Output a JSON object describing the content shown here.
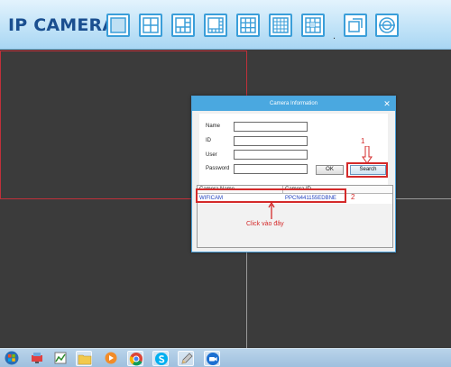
{
  "toolbar": {
    "title": "IP CAMERA",
    "buttons": [
      {
        "name": "layout-1-button",
        "icon": "single-view-icon"
      },
      {
        "name": "layout-4-button",
        "icon": "quad-view-icon"
      },
      {
        "name": "layout-6-button",
        "icon": "six-view-icon"
      },
      {
        "name": "layout-8-button",
        "icon": "eight-view-icon"
      },
      {
        "name": "layout-9-button",
        "icon": "nine-view-icon"
      },
      {
        "name": "layout-16-button",
        "icon": "sixteen-view-icon"
      },
      {
        "name": "layout-custom-button",
        "icon": "custom-view-icon"
      },
      {
        "name": "fullscreen-button",
        "icon": "fullscreen-icon"
      },
      {
        "name": "settings-button",
        "icon": "target-settings-icon"
      }
    ],
    "dot": "."
  },
  "dialog": {
    "title": "Camera Information",
    "close": "✕",
    "fields": {
      "name_label": "Name",
      "name_value": "",
      "id_label": "ID",
      "id_value": "",
      "user_label": "User",
      "user_value": "",
      "password_label": "Password",
      "password_value": ""
    },
    "ok_label": "OK",
    "search_label": "Search",
    "table": {
      "columns": [
        "Camera Name",
        "Camera ID"
      ],
      "rows": [
        {
          "name": "WIFICAM",
          "id": "PPCN441155EDBNE"
        }
      ]
    }
  },
  "annotations": {
    "step1": "1",
    "step2": "2",
    "hint": "Click vào đây"
  },
  "colors": {
    "accent": "#4aa8e0",
    "annotation": "#d42a2a",
    "title": "#1a4f90",
    "video_bg": "#3b3b3b"
  },
  "taskbar": {
    "items": [
      {
        "name": "start-button",
        "icon": "windows-logo-icon"
      },
      {
        "name": "taskbar-network-app",
        "icon": "network-app-icon"
      },
      {
        "name": "taskbar-chart-app",
        "icon": "chart-app-icon"
      },
      {
        "name": "taskbar-file-explorer",
        "icon": "folder-icon"
      },
      {
        "name": "taskbar-media-player",
        "icon": "media-player-icon"
      },
      {
        "name": "taskbar-chrome",
        "icon": "chrome-icon"
      },
      {
        "name": "taskbar-skype",
        "icon": "skype-icon"
      },
      {
        "name": "taskbar-tool",
        "icon": "pencil-tool-icon"
      },
      {
        "name": "taskbar-ip-camera",
        "icon": "camera-app-icon"
      }
    ]
  }
}
